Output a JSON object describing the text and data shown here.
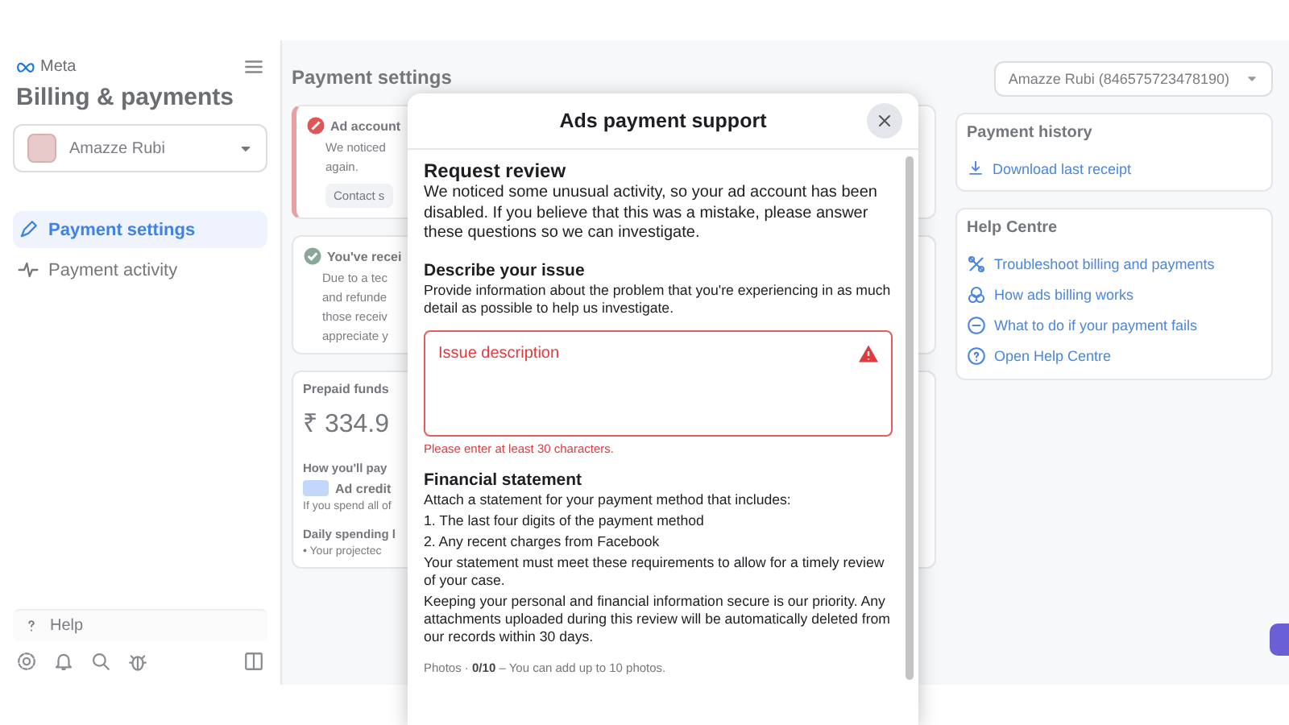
{
  "sidebar": {
    "brand": "Meta",
    "title": "Billing & payments",
    "account": "Amazze Rubi",
    "nav": [
      {
        "label": "Payment settings",
        "selected": true,
        "kind": "settings"
      },
      {
        "label": "Payment activity",
        "selected": false,
        "kind": "activity"
      }
    ],
    "help": "Help"
  },
  "main": {
    "title": "Payment settings",
    "account_selector": "Amazze Rubi (846575723478190)",
    "alert_cards": [
      {
        "kind": "error",
        "title": "Ad account",
        "lines": [
          "We noticed",
          "again."
        ],
        "button": "Contact s"
      },
      {
        "kind": "success",
        "title": "You've recei",
        "lines": [
          "Due to a tec",
          "and refunde",
          "those receiv",
          "appreciate y"
        ]
      }
    ],
    "funds": {
      "title": "Prepaid funds",
      "amount": "₹ 334.9",
      "pay_label": "How you'll pay",
      "method": "Ad credit",
      "note": "If you spend all of",
      "daily_label": "Daily spending l",
      "bullet": "• Your projectec"
    }
  },
  "right": {
    "history": {
      "title": "Payment history",
      "link": "Download last receipt"
    },
    "help_centre": {
      "title": "Help Centre",
      "links": [
        {
          "kind": "troubleshoot",
          "label": "Troubleshoot billing and payments"
        },
        {
          "kind": "billing",
          "label": "How ads billing works"
        },
        {
          "kind": "fails",
          "label": "What to do if your payment fails"
        },
        {
          "kind": "help",
          "label": "Open Help Centre"
        }
      ]
    }
  },
  "modal": {
    "title": "Ads payment support",
    "heading": "Request review",
    "intro": "We noticed some unusual activity, so your ad account has been disabled. If you believe that this was a mistake, please answer these questions so we can investigate.",
    "issue": {
      "heading": "Describe your issue",
      "text": "Provide information about the problem that you're experiencing in as much detail as possible to help us investigate.",
      "field": {
        "placeholder": "Issue description",
        "invalid": true,
        "error": "Please enter at least 30 characters."
      }
    },
    "statement": {
      "heading": "Financial statement",
      "paragraphs": [
        "Attach a statement for your payment method that includes:",
        "1. The last four digits of the payment method",
        "2. Any recent charges from Facebook",
        "Your statement must meet these requirements to allow for a timely review of your case.",
        "Keeping your personal and financial information secure is our priority. Any attachments uploaded during this review will be automatically deleted from our records within 30 days."
      ]
    },
    "photos": "Photos · **0/10** – You can add up to 10 photos."
  }
}
